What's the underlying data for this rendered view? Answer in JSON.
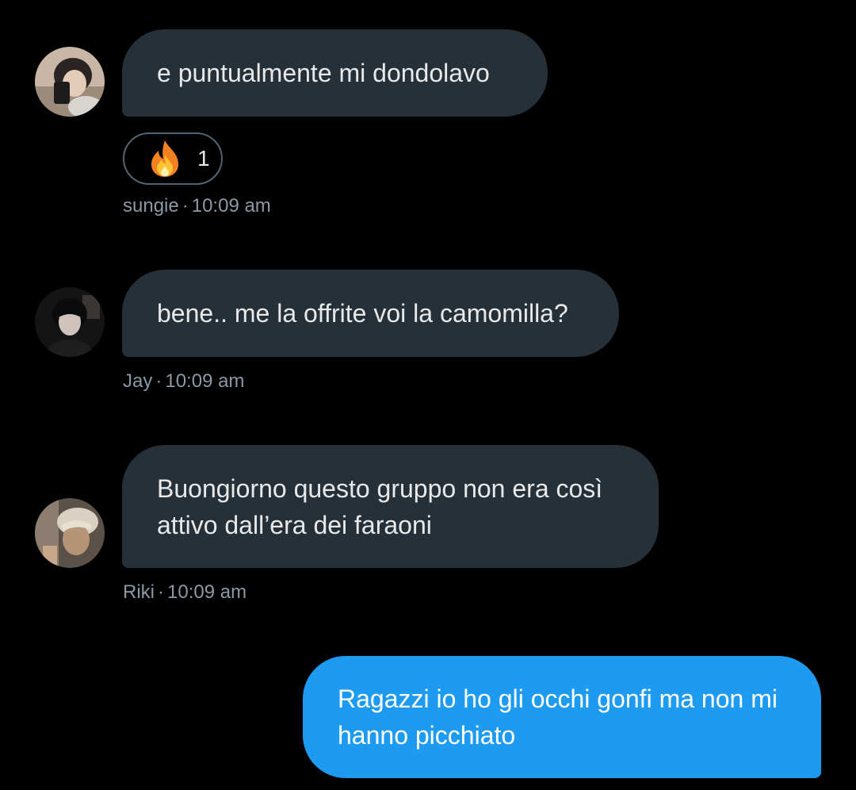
{
  "messages": [
    {
      "sender": "sungie",
      "time": "10:09 am",
      "lines": [
        "e puntualmente mi dondolavo"
      ],
      "reaction": {
        "emoji": "fire-icon",
        "count": "1"
      }
    },
    {
      "sender": "Jay",
      "time": "10:09 am",
      "lines": [
        "bene.. me la offrite voi la camomilla?"
      ]
    },
    {
      "sender": "Riki",
      "time": "10:09 am",
      "lines": [
        "Buongiorno questo gruppo non era così",
        "attivo dall’era dei faraoni"
      ]
    },
    {
      "sender": "self",
      "lines": [
        "Ragazzi io ho gli occhi gonfi ma non mi",
        "hanno picchiato"
      ]
    }
  ],
  "colors": {
    "background": "#000000",
    "incoming_bubble": "#253038",
    "outgoing_bubble": "#1d9bf0",
    "meta_text": "#8b98a5"
  }
}
